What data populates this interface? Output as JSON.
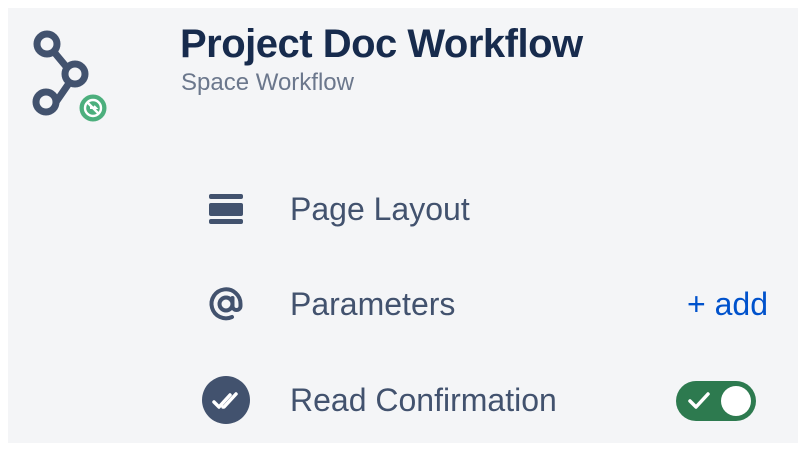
{
  "header": {
    "title": "Project Doc Workflow",
    "subtitle": "Space Workflow"
  },
  "rows": [
    {
      "label": "Page Layout",
      "icon": "page-layout-icon"
    },
    {
      "label": "Parameters",
      "icon": "at-sign-icon",
      "action": "+ add"
    },
    {
      "label": "Read Confirmation",
      "icon": "double-check-icon",
      "toggle_on": true
    }
  ],
  "colors": {
    "title": "#172b4d",
    "subtitle": "#6b778c",
    "label": "#42526e",
    "link": "#0052cc",
    "toggle_on": "#2d7a4f",
    "badge": "#4caf7d",
    "panel_bg": "#f4f5f7"
  }
}
